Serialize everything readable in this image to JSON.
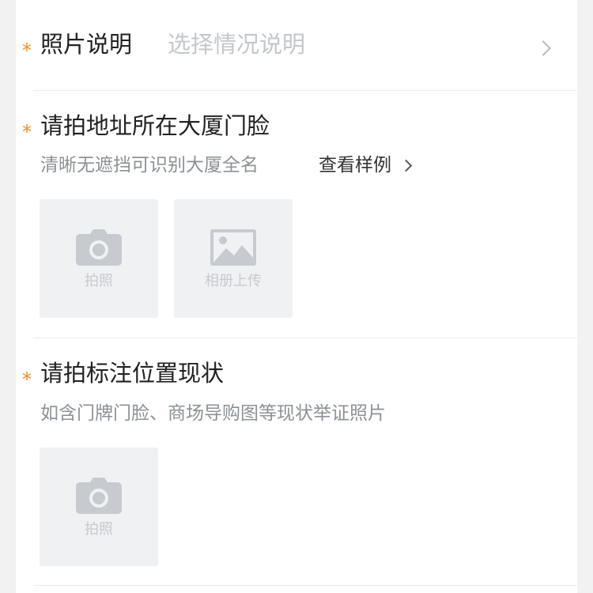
{
  "photo_description": {
    "label": "照片说明",
    "placeholder": "选择情况说明",
    "required_mark": "*"
  },
  "section_building": {
    "title": "请拍地址所在大厦门脸",
    "required_mark": "*",
    "description": "清晰无遮挡可识别大厦全名",
    "example_link": "查看样例",
    "tiles": [
      {
        "label": "拍照",
        "icon": "camera-icon"
      },
      {
        "label": "相册上传",
        "icon": "image-icon"
      }
    ]
  },
  "section_location": {
    "title": "请拍标注位置现状",
    "required_mark": "*",
    "description": "如含门牌门脸、商场导购图等现状举证照片",
    "tiles": [
      {
        "label": "拍照",
        "icon": "camera-icon"
      }
    ]
  },
  "colors": {
    "accent_star": "#f08a24",
    "tile_background": "#f0f1f3",
    "icon_gray": "#c7cacf"
  }
}
